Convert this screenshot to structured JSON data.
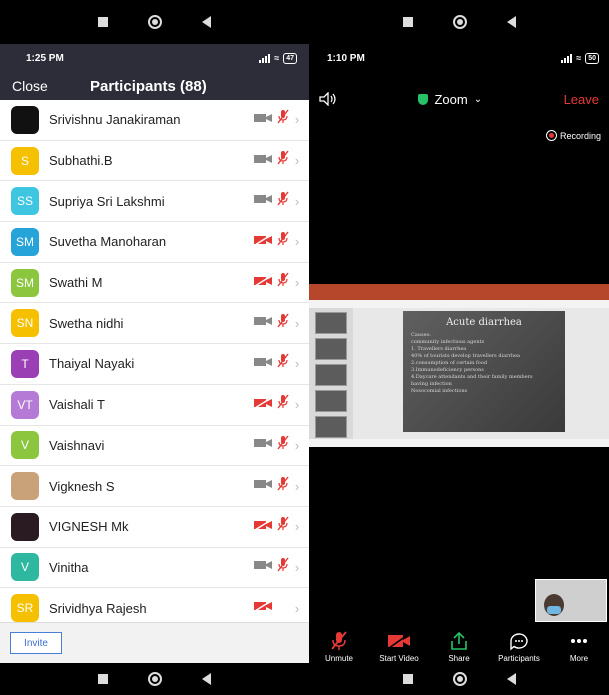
{
  "left": {
    "status": {
      "time": "1:25 PM",
      "battery": "47"
    },
    "header": {
      "close_label": "Close",
      "title": "Participants (88)"
    },
    "participants": [
      {
        "name": "Srivishnu Janakiraman",
        "initials": "",
        "color": "#111111",
        "video": "off",
        "mic": "muted"
      },
      {
        "name": "Subhathi.B",
        "initials": "S",
        "color": "#f5c000",
        "video": "off",
        "mic": "muted"
      },
      {
        "name": "Supriya Sri Lakshmi",
        "initials": "SS",
        "color": "#3ec6e0",
        "video": "off",
        "mic": "muted"
      },
      {
        "name": "Suvetha Manoharan",
        "initials": "SM",
        "color": "#26a3d9",
        "video": "blocked",
        "mic": "muted"
      },
      {
        "name": "Swathi M",
        "initials": "SM",
        "color": "#8cc63f",
        "video": "blocked",
        "mic": "muted"
      },
      {
        "name": "Swetha nidhi",
        "initials": "SN",
        "color": "#f5c000",
        "video": "off",
        "mic": "muted"
      },
      {
        "name": "Thaiyal Nayaki",
        "initials": "T",
        "color": "#9b3fb5",
        "video": "off",
        "mic": "muted"
      },
      {
        "name": "Vaishali T",
        "initials": "VT",
        "color": "#b57ad6",
        "video": "blocked",
        "mic": "muted"
      },
      {
        "name": "Vaishnavi",
        "initials": "V",
        "color": "#8cc63f",
        "video": "off",
        "mic": "muted"
      },
      {
        "name": "Vigknesh S",
        "initials": "",
        "color": "#c9a27a",
        "video": "off",
        "mic": "muted"
      },
      {
        "name": "VIGNESH Mk",
        "initials": "",
        "color": "#2a1a22",
        "video": "blocked",
        "mic": "muted"
      },
      {
        "name": "Vinitha",
        "initials": "V",
        "color": "#2fb8a0",
        "video": "off",
        "mic": "muted"
      },
      {
        "name": "Srividhya Rajesh",
        "initials": "SR",
        "color": "#f5c000",
        "video": "blocked",
        "mic": "none"
      }
    ],
    "invite_label": "Invite"
  },
  "right": {
    "status": {
      "time": "1:10 PM",
      "battery": "50"
    },
    "meeting_title": "Zoom",
    "leave_label": "Leave",
    "recording_label": "Recording",
    "slide": {
      "title": "Acute diarrhea",
      "lines": [
        "Causes:",
        "  community infectious agents",
        "  1. Travellers diarrhea",
        "    40% of tourists develop travellers diarrhea",
        "  2.consumption of certain food",
        "  3.Immunodeficiency persons",
        "  4.Daycare attendants and their family members",
        "    having infection",
        "  Nosocomial infections"
      ]
    },
    "toolbar": [
      {
        "label": "Unmute",
        "icon": "mic-muted-icon"
      },
      {
        "label": "Start Video",
        "icon": "video-off-icon"
      },
      {
        "label": "Share",
        "icon": "share-icon"
      },
      {
        "label": "Participants",
        "icon": "participants-icon"
      },
      {
        "label": "More",
        "icon": "more-icon"
      }
    ]
  }
}
